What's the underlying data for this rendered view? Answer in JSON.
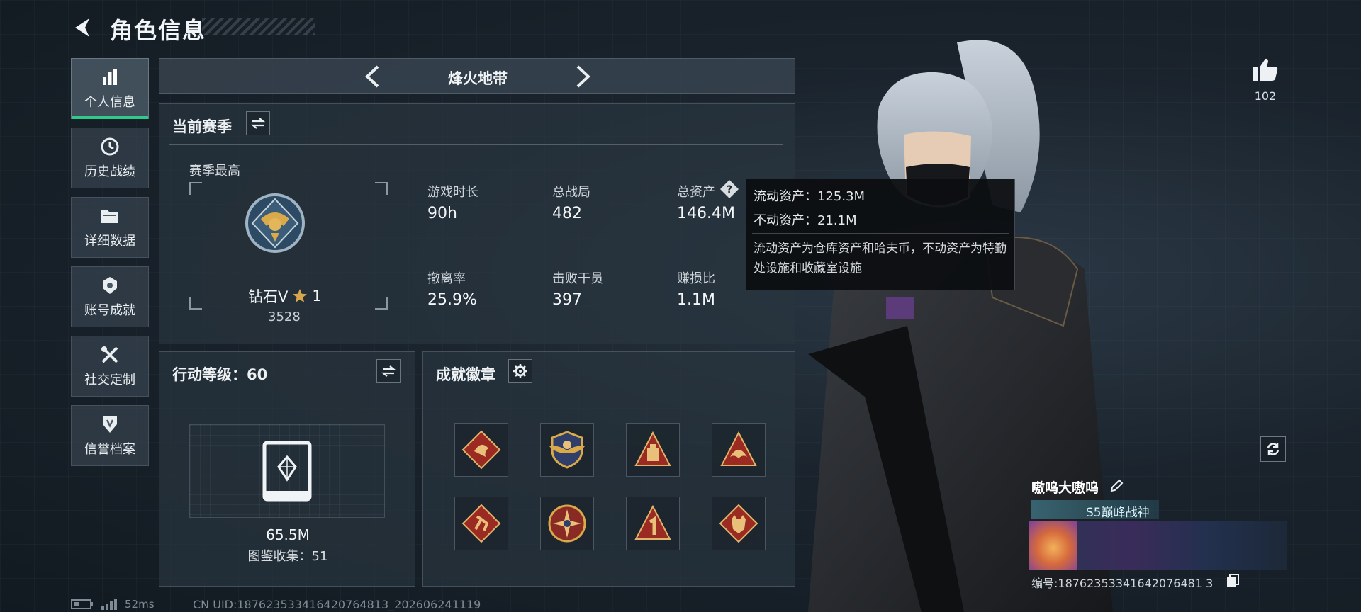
{
  "header": {
    "title": "角色信息"
  },
  "sidebar": {
    "items": [
      {
        "label": "个人信息",
        "icon": "bar-chart-icon",
        "active": true
      },
      {
        "label": "历史战绩",
        "icon": "history-clock-icon"
      },
      {
        "label": "详细数据",
        "icon": "folder-icon"
      },
      {
        "label": "账号成就",
        "icon": "achievement-icon"
      },
      {
        "label": "社交定制",
        "icon": "tools-icon"
      },
      {
        "label": "信誉档案",
        "icon": "shield-icon"
      }
    ]
  },
  "mode_selector": {
    "label": "烽火地带"
  },
  "season": {
    "title": "当前赛季",
    "best_label": "赛季最高",
    "rank_name": "钻石V",
    "rank_stars": "1",
    "rank_score": "3528",
    "stats": [
      {
        "label": "游戏时长",
        "value": "90h"
      },
      {
        "label": "总战局",
        "value": "482"
      },
      {
        "label": "总资产",
        "value": "146.4M"
      },
      {
        "label": "撤离率",
        "value": "25.9%"
      },
      {
        "label": "击败干员",
        "value": "397"
      },
      {
        "label": "赚损比",
        "value": "1.1M"
      }
    ]
  },
  "tooltip": {
    "liquid": "流动资产：125.3M",
    "fixed": "不动资产：21.1M",
    "desc": "流动资产为仓库资产和哈夫币，不动资产为特勤处设施和收藏室设施"
  },
  "action_level": {
    "title": "行动等级：60",
    "value": "65.5M",
    "collection": "图鉴收集：51"
  },
  "achievements": {
    "title": "成就徽章",
    "badges": [
      "dragon-badge-icon",
      "shield-wing-badge-icon",
      "triangle-tower-badge-icon",
      "phoenix-badge-icon",
      "runner-badge-icon",
      "star-cross-badge-icon",
      "number-one-badge-icon",
      "wolf-badge-icon"
    ]
  },
  "likes": {
    "count": "102",
    "icon": "thumbs-up-icon"
  },
  "player": {
    "name": "嗷呜大嗷呜",
    "title": "S5巅峰战神",
    "uid": "编号:18762353341642076481 3"
  },
  "footer": {
    "ping": "52ms",
    "uid": "CN UID:187623533416420764813_202606241119"
  },
  "colors": {
    "accent": "#2fc98b",
    "gold": "#d6a84a",
    "badge_red": "#9b2b22"
  }
}
